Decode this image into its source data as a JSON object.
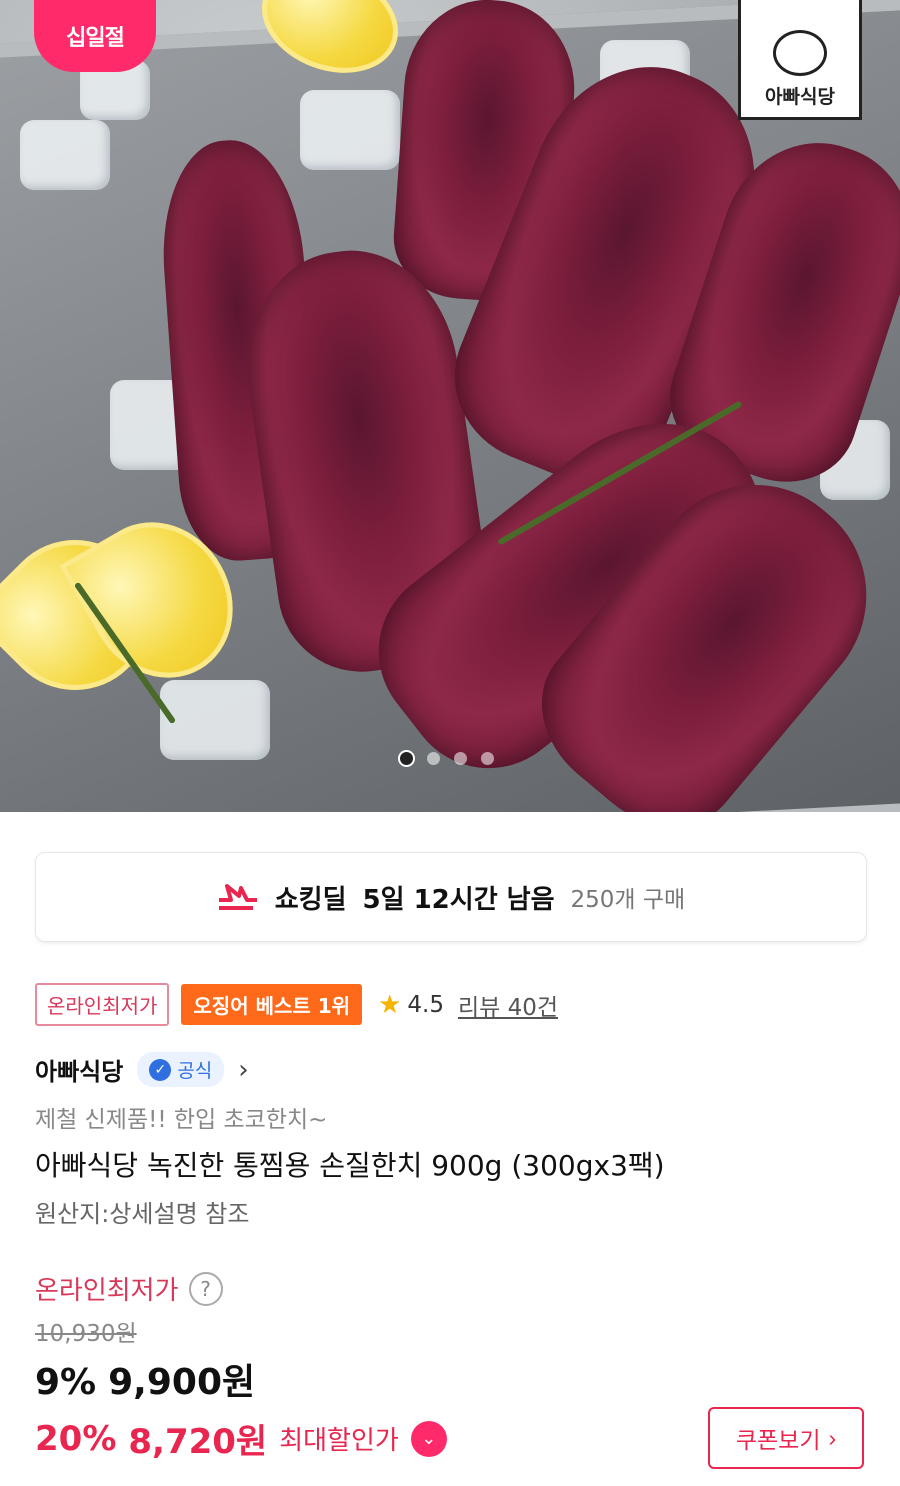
{
  "hero": {
    "sale_badge": "십일절",
    "brand_logo_text": "아빠식당",
    "carousel_dots": 4,
    "carousel_active": 1
  },
  "deal": {
    "icon": "lightning-bolt-icon",
    "title": "쇼킹딜",
    "timer": "5일 12시간 남음",
    "purchase_count": "250개 구매"
  },
  "tags": {
    "lowest_online": "온라인최저가",
    "best_rank": "오징어 베스트 1위"
  },
  "rating": {
    "score": "4.5",
    "reviews": "리뷰 40건"
  },
  "seller": {
    "name": "아빠식당",
    "official_badge": "공식"
  },
  "product": {
    "promo_line": "제철 신제품!! 한입 초코한치~",
    "title": "아빠식당 녹진한 통찜용 손질한치 900g (300gx3팩)",
    "origin": "원산지:상세설명 참조"
  },
  "pricing": {
    "lowest_label": "온라인최저가",
    "original_price": "10,930원",
    "discount1_pct": "9%",
    "discount1_price": "9,900원",
    "discount2_pct": "20%",
    "discount2_price": "8,720원",
    "max_discount_label": "최대할인가",
    "coupon_button": "쿠폰보기"
  },
  "colors": {
    "accent": "#e8264f",
    "best_tag": "#ff6a1a",
    "official_blue": "#2f6fe0"
  }
}
